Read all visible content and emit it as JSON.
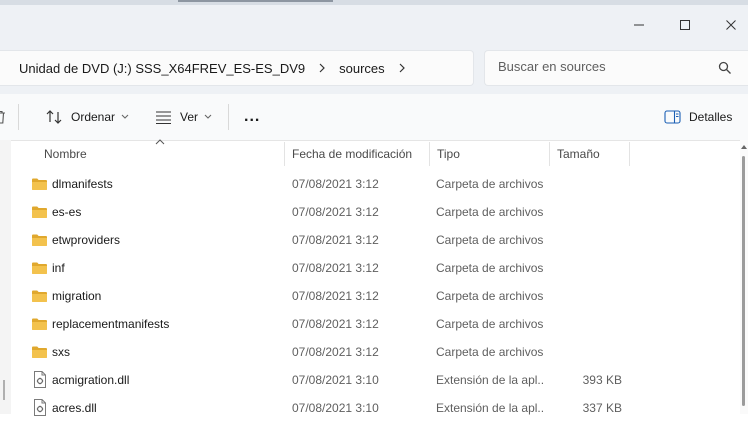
{
  "address": {
    "crumbs": [
      "Unidad de DVD (J:) SSS_X64FREV_ES-ES_DV9",
      "sources"
    ]
  },
  "search": {
    "placeholder": "Buscar en sources"
  },
  "toolbar": {
    "sort_label": "Ordenar",
    "view_label": "Ver",
    "more_label": "...",
    "details_label": "Detalles"
  },
  "columns": {
    "name": "Nombre",
    "date": "Fecha de modificación",
    "type": "Tipo",
    "size": "Tamaño"
  },
  "files": [
    {
      "icon": "folder-icon",
      "name": "dlmanifests",
      "date": "07/08/2021 3:12",
      "type": "Carpeta de archivos",
      "size": ""
    },
    {
      "icon": "folder-icon",
      "name": "es-es",
      "date": "07/08/2021 3:12",
      "type": "Carpeta de archivos",
      "size": ""
    },
    {
      "icon": "folder-icon",
      "name": "etwproviders",
      "date": "07/08/2021 3:12",
      "type": "Carpeta de archivos",
      "size": ""
    },
    {
      "icon": "folder-icon",
      "name": "inf",
      "date": "07/08/2021 3:12",
      "type": "Carpeta de archivos",
      "size": ""
    },
    {
      "icon": "folder-icon",
      "name": "migration",
      "date": "07/08/2021 3:12",
      "type": "Carpeta de archivos",
      "size": ""
    },
    {
      "icon": "folder-icon",
      "name": "replacementmanifests",
      "date": "07/08/2021 3:12",
      "type": "Carpeta de archivos",
      "size": ""
    },
    {
      "icon": "folder-icon",
      "name": "sxs",
      "date": "07/08/2021 3:12",
      "type": "Carpeta de archivos",
      "size": ""
    },
    {
      "icon": "dll-file-icon",
      "name": "acmigration.dll",
      "date": "07/08/2021 3:10",
      "type": "Extensión de la apl...",
      "size": "393 KB"
    },
    {
      "icon": "dll-file-icon",
      "name": "acres.dll",
      "date": "07/08/2021 3:10",
      "type": "Extensión de la apl...",
      "size": "337 KB"
    }
  ],
  "colors": {
    "folder": "#f3c24d",
    "folder_dark": "#e0a82e",
    "chrome_bg": "#eef1f5"
  }
}
